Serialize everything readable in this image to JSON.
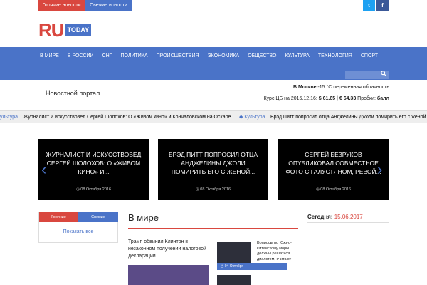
{
  "topbar": {
    "hot_news": "Горячие новости",
    "fresh_news": "Свежие новости",
    "twitter_icon": "twitter-icon",
    "facebook_icon": "facebook-icon"
  },
  "logo": {
    "ru": "RU",
    "today": "TODAY"
  },
  "nav": [
    "В мире",
    "В России",
    "СНГ",
    "Политика",
    "Происшествия",
    "Экономика",
    "Общество",
    "Культура",
    "Технология",
    "Спорт"
  ],
  "search": {
    "icon": "search-icon"
  },
  "portal_title": "Новостной портал",
  "weather": {
    "city": "В Москве",
    "text": "-15 °C переменная облачность"
  },
  "rates": {
    "label": "Курс ЦБ на 2016.12.16:",
    "usd": "$ 61.65",
    "sep": "|",
    "eur": "€ 64.33",
    "traffic_label": "Пробки:",
    "traffic_value": "балл"
  },
  "ticker": {
    "cat1": "ультура",
    "text1": "Журналист и искусствовед Сергей Шолохов: О «Живом кино» и Кончаловском на Оскаре",
    "cat2": "Культура",
    "text2": "Брэд Питт попросил отца Анджелины Джоли помирить его с женой"
  },
  "slides": [
    {
      "title": "Журналист и искусствовед Сергей Шолохов: О «Живом кино» и...",
      "date": "08 Октября 2016"
    },
    {
      "title": "Брэд Питт попросил отца Анджелины Джоли помирить его с женой...",
      "date": "08 Октября 2016"
    },
    {
      "title": "Сергей Безруков опубликовал совместное фото с Галустяном, ревой...",
      "date": "08 Октября 2016"
    }
  ],
  "sidebar_tabs": {
    "hot": "Горячие",
    "fresh": "Свежие",
    "show_all": "Показать все"
  },
  "section": {
    "title": "В мире",
    "main_news": "Трамп обвинил Клинтон в незаконном получении налоговой декларации",
    "side_news": "Вопросы по Южно-Китайскому морю должны решаться диалогом, считают",
    "side_date": "04 Октября"
  },
  "today": {
    "label": "Сегодня:",
    "date": "15.06.2017"
  }
}
